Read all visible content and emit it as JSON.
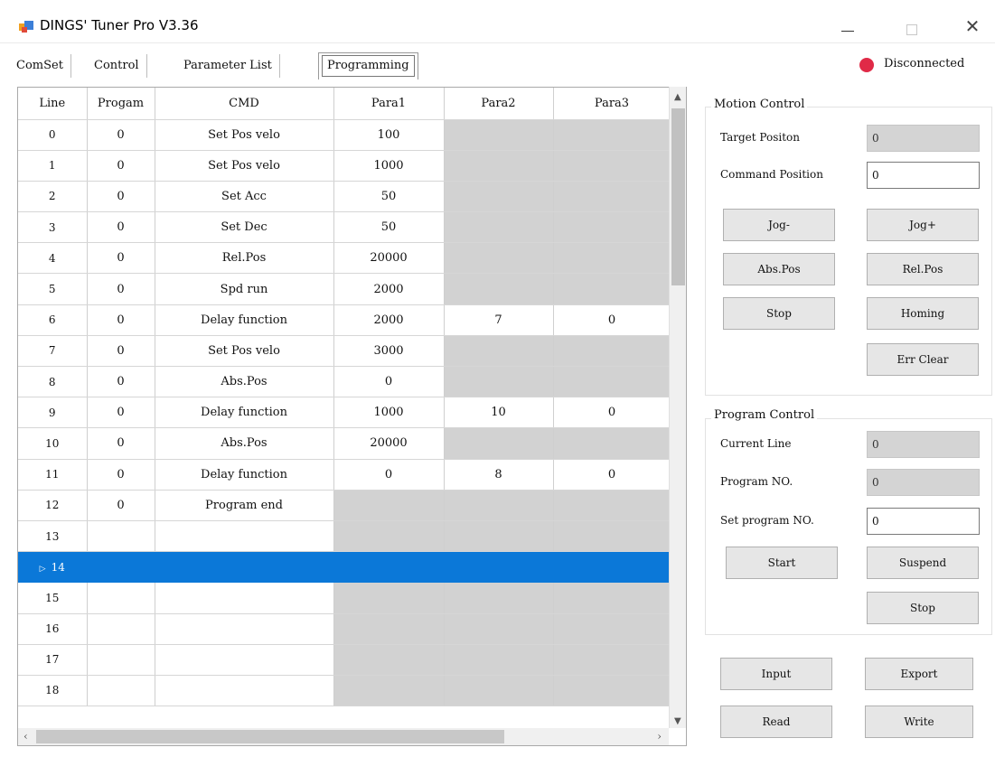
{
  "window": {
    "title": "DINGS' Tuner Pro V3.36",
    "close_glyph": "✕"
  },
  "tabs": [
    "ComSet",
    "Control",
    "Parameter List",
    "Programming"
  ],
  "status": {
    "text": "Disconnected",
    "color": "#e02a47"
  },
  "grid": {
    "columns": [
      "Line",
      "Progam",
      "CMD",
      "Para1",
      "Para2",
      "Para3"
    ],
    "selected_row": 14,
    "selection_color": "#0b78d8",
    "rows": [
      {
        "line": "0",
        "prog": "0",
        "cmd": "Set Pos velo",
        "p1": "100",
        "p2": "",
        "p3": ""
      },
      {
        "line": "1",
        "prog": "0",
        "cmd": "Set Pos velo",
        "p1": "1000",
        "p2": "",
        "p3": ""
      },
      {
        "line": "2",
        "prog": "0",
        "cmd": "Set Acc",
        "p1": "50",
        "p2": "",
        "p3": ""
      },
      {
        "line": "3",
        "prog": "0",
        "cmd": "Set Dec",
        "p1": "50",
        "p2": "",
        "p3": ""
      },
      {
        "line": "4",
        "prog": "0",
        "cmd": "Rel.Pos",
        "p1": "20000",
        "p2": "",
        "p3": ""
      },
      {
        "line": "5",
        "prog": "0",
        "cmd": "Spd run",
        "p1": "2000",
        "p2": "",
        "p3": ""
      },
      {
        "line": "6",
        "prog": "0",
        "cmd": "Delay function",
        "p1": "2000",
        "p2": "7",
        "p3": "0"
      },
      {
        "line": "7",
        "prog": "0",
        "cmd": "Set Pos velo",
        "p1": "3000",
        "p2": "",
        "p3": ""
      },
      {
        "line": "8",
        "prog": "0",
        "cmd": "Abs.Pos",
        "p1": "0",
        "p2": "",
        "p3": ""
      },
      {
        "line": "9",
        "prog": "0",
        "cmd": "Delay function",
        "p1": "1000",
        "p2": "10",
        "p3": "0"
      },
      {
        "line": "10",
        "prog": "0",
        "cmd": "Abs.Pos",
        "p1": "20000",
        "p2": "",
        "p3": ""
      },
      {
        "line": "11",
        "prog": "0",
        "cmd": "Delay function",
        "p1": "0",
        "p2": "8",
        "p3": "0"
      },
      {
        "line": "12",
        "prog": "0",
        "cmd": "Program end",
        "p1": "",
        "p2": "",
        "p3": ""
      },
      {
        "line": "13",
        "prog": "",
        "cmd": "",
        "p1": "",
        "p2": "",
        "p3": ""
      },
      {
        "line": "14",
        "prog": "",
        "cmd": "",
        "p1": "",
        "p2": "",
        "p3": ""
      },
      {
        "line": "15",
        "prog": "",
        "cmd": "",
        "p1": "",
        "p2": "",
        "p3": ""
      },
      {
        "line": "16",
        "prog": "",
        "cmd": "",
        "p1": "",
        "p2": "",
        "p3": ""
      },
      {
        "line": "17",
        "prog": "",
        "cmd": "",
        "p1": "",
        "p2": "",
        "p3": ""
      },
      {
        "line": "18",
        "prog": "",
        "cmd": "",
        "p1": "",
        "p2": "",
        "p3": ""
      }
    ]
  },
  "motion": {
    "title": "Motion Control",
    "target_label": "Target Positon",
    "target_value": "0",
    "command_label": "Command Position",
    "command_value": "0",
    "buttons": {
      "jog_minus": "Jog-",
      "jog_plus": "Jog+",
      "abs_pos": "Abs.Pos",
      "rel_pos": "Rel.Pos",
      "stop": "Stop",
      "homing": "Homing",
      "err_clear": "Err Clear"
    }
  },
  "program": {
    "title": "Program Control",
    "current_line_label": "Current Line",
    "current_line_value": "0",
    "program_no_label": "Program NO.",
    "program_no_value": "0",
    "set_program_label": "Set program NO.",
    "set_program_value": "0",
    "buttons": {
      "start": "Start",
      "suspend": "Suspend",
      "stop": "Stop"
    }
  },
  "io_buttons": {
    "input": "Input",
    "export": "Export",
    "read": "Read",
    "write": "Write"
  }
}
